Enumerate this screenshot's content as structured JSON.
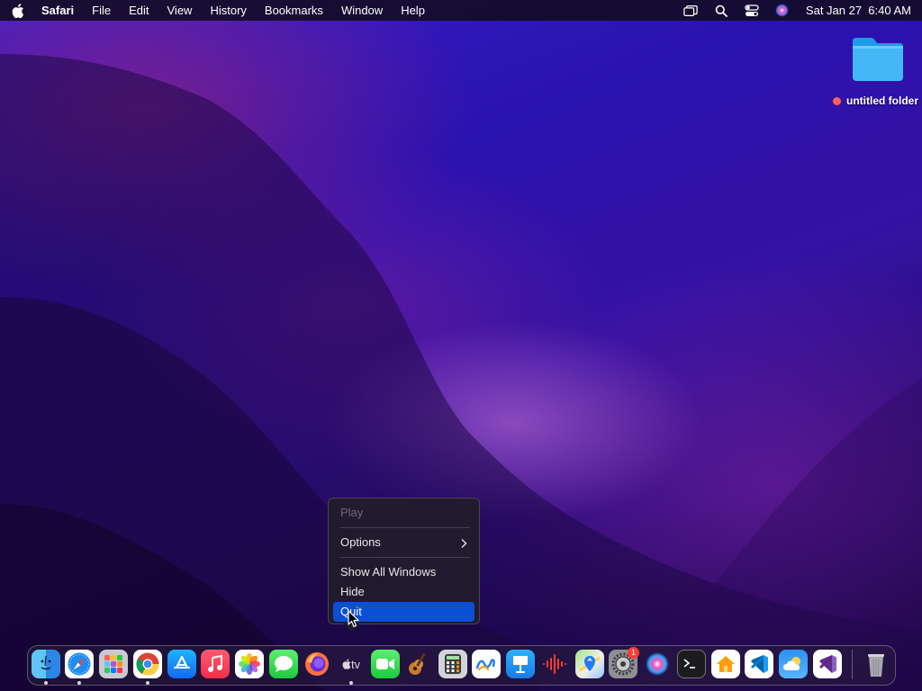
{
  "menubar": {
    "apple_icon": "apple-logo-icon",
    "app_name": "Safari",
    "items": [
      "File",
      "Edit",
      "View",
      "History",
      "Bookmarks",
      "Window",
      "Help"
    ],
    "status_icons": [
      "screen-mirroring-icon",
      "spotlight-search-icon",
      "control-center-icon",
      "siri-icon"
    ],
    "clock": "Sat Jan 27  6:40 AM"
  },
  "desktop": {
    "folder": {
      "label": "untitled folder",
      "tag_color": "#ff5f57"
    }
  },
  "context_menu": {
    "items": [
      {
        "label": "Play",
        "enabled": false
      },
      {
        "label": "Options",
        "submenu": true
      },
      {
        "label": "Show All Windows"
      },
      {
        "label": "Hide"
      },
      {
        "label": "Quit",
        "highlighted": true
      }
    ],
    "highlight_color": "#0a4fd6"
  },
  "dock": {
    "apps": [
      "Finder",
      "Safari",
      "Launchpad",
      "Google Chrome",
      "App Store",
      "Music",
      "Photos",
      "Messages",
      "Firefox",
      "TV",
      "FaceTime",
      "GarageBand",
      "Calculator",
      "Freeform",
      "Keynote",
      "Voice Memos",
      "Maps",
      "System Settings",
      "Siri",
      "Terminal",
      "Home",
      "Visual Studio Code",
      "Weather",
      "Visual Studio",
      "Trash"
    ],
    "tv_label": "tv",
    "system_settings_badge": "1"
  }
}
